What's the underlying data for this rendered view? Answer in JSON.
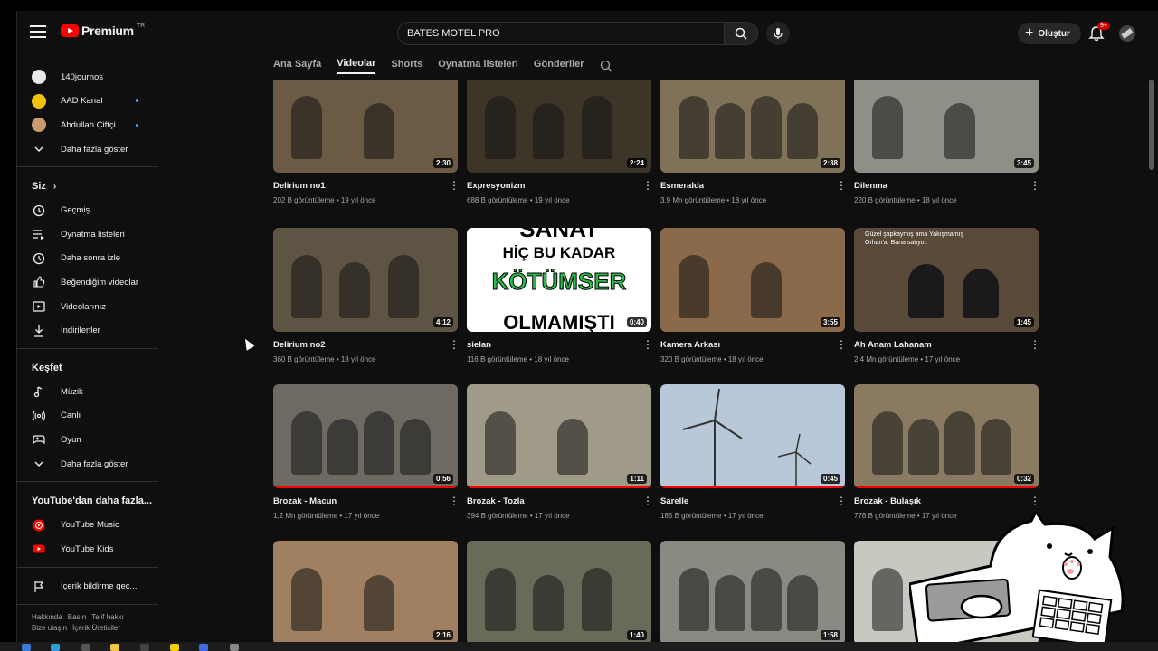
{
  "header": {
    "logo_word": "Premium",
    "logo_country": "TR",
    "search_value": "BATES MOTEL PRO",
    "create_label": "Oluştur",
    "notif_count": "9+"
  },
  "sidebar": {
    "subscriptions": [
      {
        "label": "140journos",
        "color": "#e9e9e9",
        "dot": false
      },
      {
        "label": "AAD Kanal",
        "color": "#f4c20d",
        "dot": true
      },
      {
        "label": "Abdullah Çiftçi",
        "color": "#c99a6b",
        "dot": true
      }
    ],
    "show_more": "Daha fazla göster",
    "you_section": "Siz",
    "you_items": [
      {
        "label": "Geçmiş",
        "icon": "history-icon"
      },
      {
        "label": "Oynatma listeleri",
        "icon": "playlists-icon"
      },
      {
        "label": "Daha sonra izle",
        "icon": "watch-later-icon"
      },
      {
        "label": "Beğendiğim videolar",
        "icon": "like-icon"
      },
      {
        "label": "Videolarınız",
        "icon": "your-videos-icon"
      },
      {
        "label": "İndirilenler",
        "icon": "download-icon"
      }
    ],
    "explore_section": "Keşfet",
    "explore_items": [
      {
        "label": "Müzik",
        "icon": "music-icon"
      },
      {
        "label": "Canlı",
        "icon": "live-icon"
      },
      {
        "label": "Oyun",
        "icon": "gaming-icon"
      }
    ],
    "explore_more": "Daha fazla göster",
    "more_section": "YouTube'dan daha fazla...",
    "more_items": [
      {
        "label": "YouTube Music",
        "icon": "youtube-music-icon"
      },
      {
        "label": "YouTube Kids",
        "icon": "youtube-kids-icon"
      }
    ],
    "report_label": "İçerik bildirme geç...",
    "footer_line1": [
      "Hakkında",
      "Basın",
      "Telif hakkı"
    ],
    "footer_line2": [
      "Bize ulaşın",
      "İçerik Üreticiler"
    ]
  },
  "tabs": [
    "Ana Sayfa",
    "Videolar",
    "Shorts",
    "Oynatma listeleri",
    "Gönderiler"
  ],
  "active_tab": "Videolar",
  "videos": [
    {
      "title": "Delirium no1",
      "views": "202 B görüntüleme",
      "age": "19 yıl önce",
      "duration": "2:30",
      "bg": "#6b5a44",
      "progress": 0
    },
    {
      "title": "Expresyonizm",
      "views": "688 B görüntüleme",
      "age": "19 yıl önce",
      "duration": "2:24",
      "bg": "#3d3527",
      "progress": 0
    },
    {
      "title": "Esmeralda",
      "views": "3,9 Mn görüntüleme",
      "age": "18 yıl önce",
      "duration": "2:38",
      "bg": "#807258",
      "progress": 0
    },
    {
      "title": "Dilenma",
      "views": "220 B görüntüleme",
      "age": "18 yıl önce",
      "duration": "3:45",
      "bg": "#8f8f88",
      "progress": 0
    },
    {
      "title": "Delirium no2",
      "views": "360 B görüntüleme",
      "age": "18 yıl önce",
      "duration": "4:12",
      "bg": "#5e5443",
      "progress": 0
    },
    {
      "title": "sielan",
      "views": "116 B görüntüleme",
      "age": "18 yıl önce",
      "duration": "0:40",
      "bg": "#ffffff",
      "progress": 0
    },
    {
      "title": "Kamera Arkası",
      "views": "320 B görüntüleme",
      "age": "18 yıl önce",
      "duration": "3:55",
      "bg": "#8a6a4a",
      "progress": 0
    },
    {
      "title": "Ah Anam Lahanam",
      "views": "2,4 Mn görüntüleme",
      "age": "17 yıl önce",
      "duration": "1:45",
      "bg": "#5a4a3a",
      "progress": 0
    },
    {
      "title": "Brozak - Macun",
      "views": "1,2 Mn görüntüleme",
      "age": "17 yıl önce",
      "duration": "0:56",
      "bg": "#6e6a62",
      "progress": 1
    },
    {
      "title": "Brozak - Tozla",
      "views": "394 B görüntüleme",
      "age": "17 yıl önce",
      "duration": "1:11",
      "bg": "#a09a88",
      "progress": 1
    },
    {
      "title": "Sarelle",
      "views": "185 B görüntüleme",
      "age": "17 yıl önce",
      "duration": "0:45",
      "bg": "#b8c8d8",
      "progress": 1
    },
    {
      "title": "Brozak - Bulaşık",
      "views": "776 B görüntüleme",
      "age": "17 yıl önce",
      "duration": "0:32",
      "bg": "#8a7a62",
      "progress": 1
    },
    {
      "title": "",
      "views": "",
      "age": "",
      "duration": "2:16",
      "bg": "#a08060",
      "progress": 1
    },
    {
      "title": "",
      "views": "",
      "age": "",
      "duration": "1:40",
      "bg": "#6a6a5a",
      "progress": 1
    },
    {
      "title": "",
      "views": "",
      "age": "",
      "duration": "1:58",
      "bg": "#8a8a82",
      "progress": 0
    },
    {
      "title": "",
      "views": "",
      "age": "",
      "duration": "",
      "bg": "#c8c8c0",
      "progress": 0
    }
  ],
  "sielan_text": {
    "line1": "SANAT",
    "line2": "HİÇ BU KADAR",
    "line3": "KÖTÜMSER",
    "line4": "OLMAMIŞTI"
  },
  "ah_anam_caption": "Güzel şapkaymış ama Yakışmamış Orhan'a. Bana satıyor."
}
